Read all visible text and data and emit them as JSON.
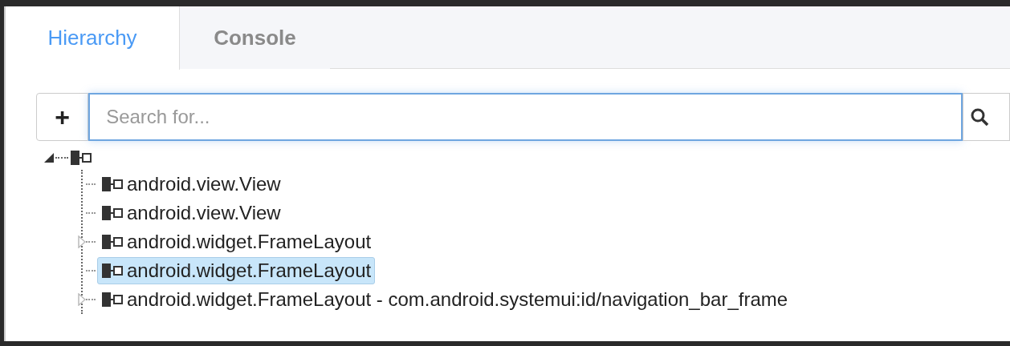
{
  "tabs": [
    {
      "label": "Hierarchy",
      "selected": true
    },
    {
      "label": "Console",
      "selected": false
    }
  ],
  "search": {
    "add_button": "+",
    "placeholder": "Search for..."
  },
  "tree": {
    "expanded": true,
    "children": [
      {
        "label": "android.view.View",
        "expandable": false,
        "selected": false
      },
      {
        "label": "android.view.View",
        "expandable": false,
        "selected": false
      },
      {
        "label": "android.widget.FrameLayout",
        "expandable": true,
        "selected": false
      },
      {
        "label": "android.widget.FrameLayout",
        "expandable": false,
        "selected": true
      },
      {
        "label": "android.widget.FrameLayout - com.android.systemui:id/navigation_bar_frame",
        "expandable": true,
        "selected": false
      }
    ]
  }
}
